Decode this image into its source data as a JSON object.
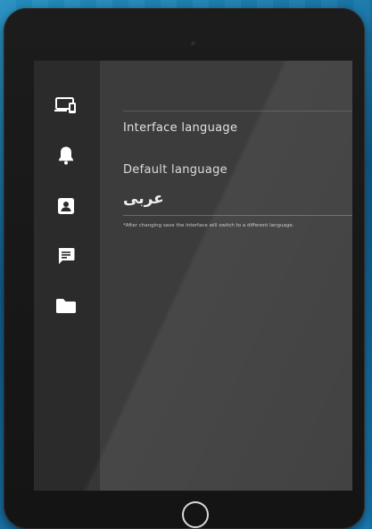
{
  "settings": {
    "section_title": "Interface language",
    "default_language_label": "Default language",
    "default_language_value": "عربى",
    "note": "*After changing save the interface will switch to a different language."
  },
  "sidebar": {
    "items": [
      {
        "name": "devices",
        "icon": "devices-icon"
      },
      {
        "name": "notifications",
        "icon": "bell-icon"
      },
      {
        "name": "contacts",
        "icon": "contact-icon"
      },
      {
        "name": "messages",
        "icon": "message-icon"
      },
      {
        "name": "files",
        "icon": "folder-icon"
      }
    ]
  },
  "colors": {
    "screen_bg": "#3c3c3c",
    "sidebar_bg": "#2b2b2b",
    "text": "#e2e2e2",
    "icon": "#ffffff"
  }
}
